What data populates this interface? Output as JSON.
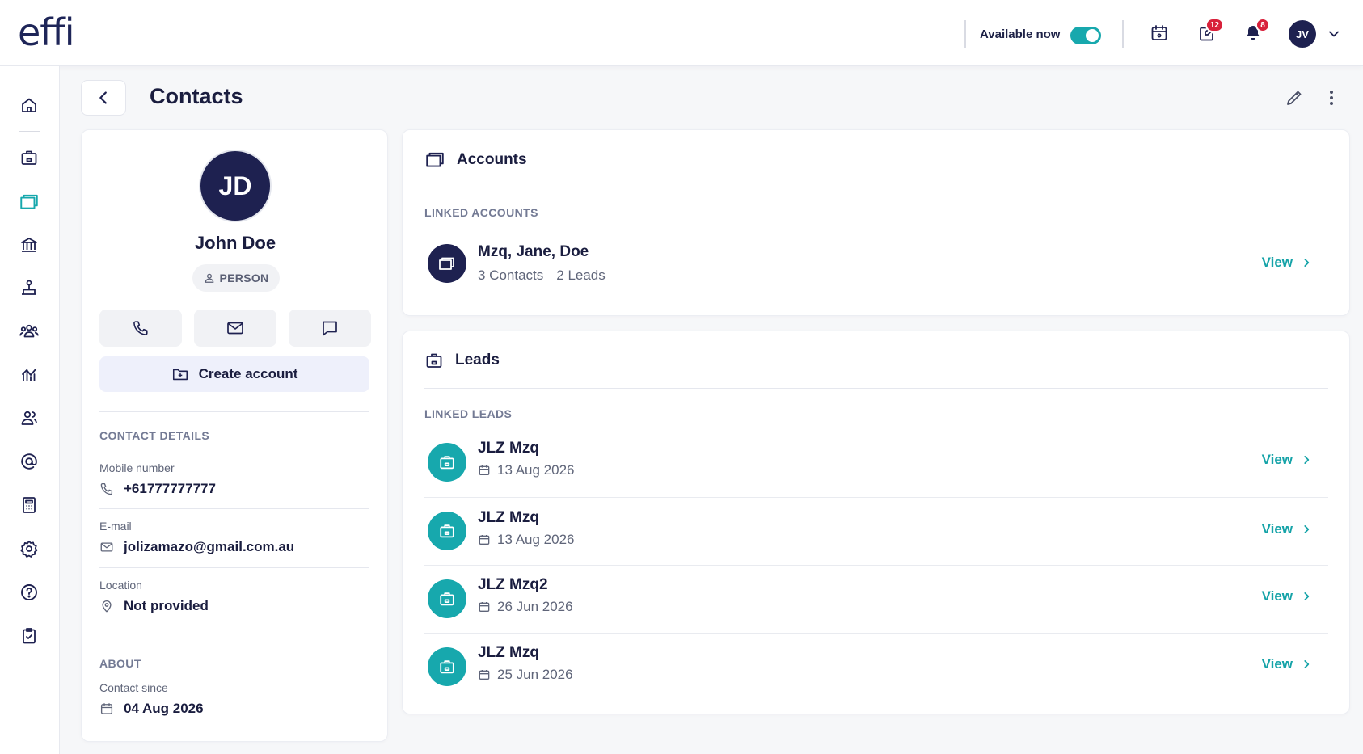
{
  "app": {
    "logo": "effi"
  },
  "topbar": {
    "availability_label": "Available now",
    "availability_on": true,
    "tasks_badge": "12",
    "notifications_badge": "8",
    "user_initials": "JV"
  },
  "sidebar": {
    "items": [
      {
        "name": "home",
        "icon": "home-icon"
      },
      {
        "name": "leads",
        "icon": "briefcase-icon"
      },
      {
        "name": "accounts",
        "icon": "folders-icon",
        "active": true
      },
      {
        "name": "institutions",
        "icon": "bank-icon"
      },
      {
        "name": "structure",
        "icon": "org-icon"
      },
      {
        "name": "team",
        "icon": "group-icon"
      },
      {
        "name": "reports",
        "icon": "chart-icon"
      },
      {
        "name": "contacts",
        "icon": "contacts-icon"
      },
      {
        "name": "email",
        "icon": "at-icon"
      },
      {
        "name": "calculator",
        "icon": "calculator-icon"
      },
      {
        "name": "settings",
        "icon": "gear-icon"
      },
      {
        "name": "help",
        "icon": "help-icon"
      },
      {
        "name": "tasks",
        "icon": "clipboard-icon"
      }
    ]
  },
  "page": {
    "title": "Contacts"
  },
  "profile": {
    "initials": "JD",
    "name": "John Doe",
    "type": "PERSON",
    "create_account_label": "Create account",
    "contact_details_heading": "CONTACT DETAILS",
    "mobile_label": "Mobile number",
    "mobile_value": "+61777777777",
    "email_label": "E-mail",
    "email_value": "jolizamazo@gmail.com.au",
    "location_label": "Location",
    "location_value": "Not provided",
    "about_heading": "ABOUT",
    "contact_since_label": "Contact since",
    "contact_since_value": "04 Aug 2026"
  },
  "accounts": {
    "title": "Accounts",
    "linked_label": "LINKED ACCOUNTS",
    "items": [
      {
        "name": "Mzq, Jane, Doe",
        "contacts": "3 Contacts",
        "leads": "2 Leads",
        "view": "View"
      }
    ]
  },
  "leads": {
    "title": "Leads",
    "linked_label": "LINKED LEADS",
    "items": [
      {
        "name": "JLZ Mzq",
        "date": "13 Aug 2026",
        "view": "View"
      },
      {
        "name": "JLZ Mzq",
        "date": "13 Aug 2026",
        "view": "View"
      },
      {
        "name": "JLZ Mzq2",
        "date": "26 Jun 2026",
        "view": "View"
      },
      {
        "name": "JLZ Mzq",
        "date": "25 Jun 2026",
        "view": "View"
      }
    ]
  },
  "colors": {
    "navy": "#1e2150",
    "teal": "#17a8ad",
    "badge_red": "#d8213b",
    "background": "#f6f7f9"
  }
}
